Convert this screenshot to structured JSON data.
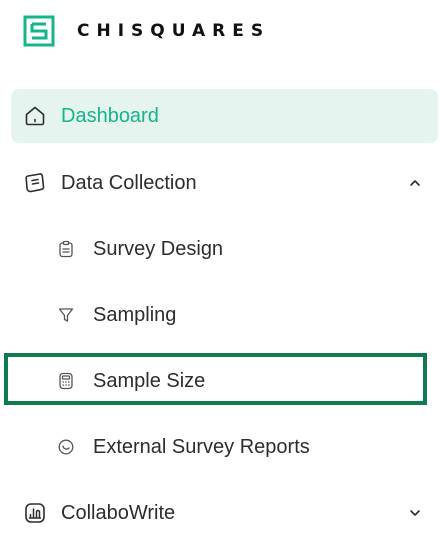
{
  "brand": {
    "name": "CHISQUARES",
    "logo_icon": "chisquares-logo-icon",
    "accent_color": "#14b58a"
  },
  "nav": {
    "dashboard": {
      "label": "Dashboard",
      "icon": "home-icon",
      "active": true
    },
    "data_collection": {
      "label": "Data Collection",
      "icon": "data-collection-icon",
      "expanded": true,
      "children": [
        {
          "label": "Survey Design",
          "icon": "clipboard-icon"
        },
        {
          "label": "Sampling",
          "icon": "funnel-icon"
        },
        {
          "label": "Sample Size",
          "icon": "calculator-icon",
          "highlighted": true
        },
        {
          "label": "External Survey Reports",
          "icon": "report-icon"
        }
      ]
    },
    "collabowrite": {
      "label": "CollaboWrite",
      "icon": "collabowrite-icon",
      "expanded": false
    }
  },
  "highlight_color": "#0f7a4f"
}
